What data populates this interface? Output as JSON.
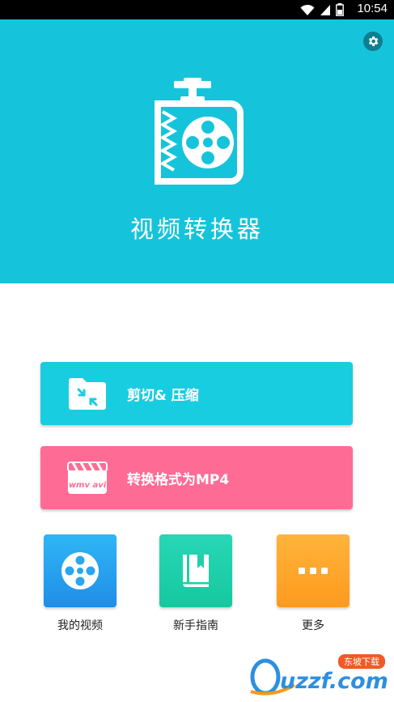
{
  "status_bar": {
    "time": "10:54"
  },
  "hero": {
    "title": "视频转换器",
    "color": "#15c4da"
  },
  "actions": [
    {
      "label": "剪切& 压缩",
      "color": "#19cde0"
    },
    {
      "label": "转换格式为MP4",
      "color": "#fe6c96",
      "icon_text": "wmv avi"
    }
  ],
  "tiles": [
    {
      "label": "我的视频",
      "color": "#2fb6f5"
    },
    {
      "label": "新手指南",
      "color": "#27d7b6"
    },
    {
      "label": "更多",
      "color": "#ffb43a"
    }
  ],
  "watermark": {
    "text": "uzzf.com",
    "badge": "东坡下载"
  }
}
